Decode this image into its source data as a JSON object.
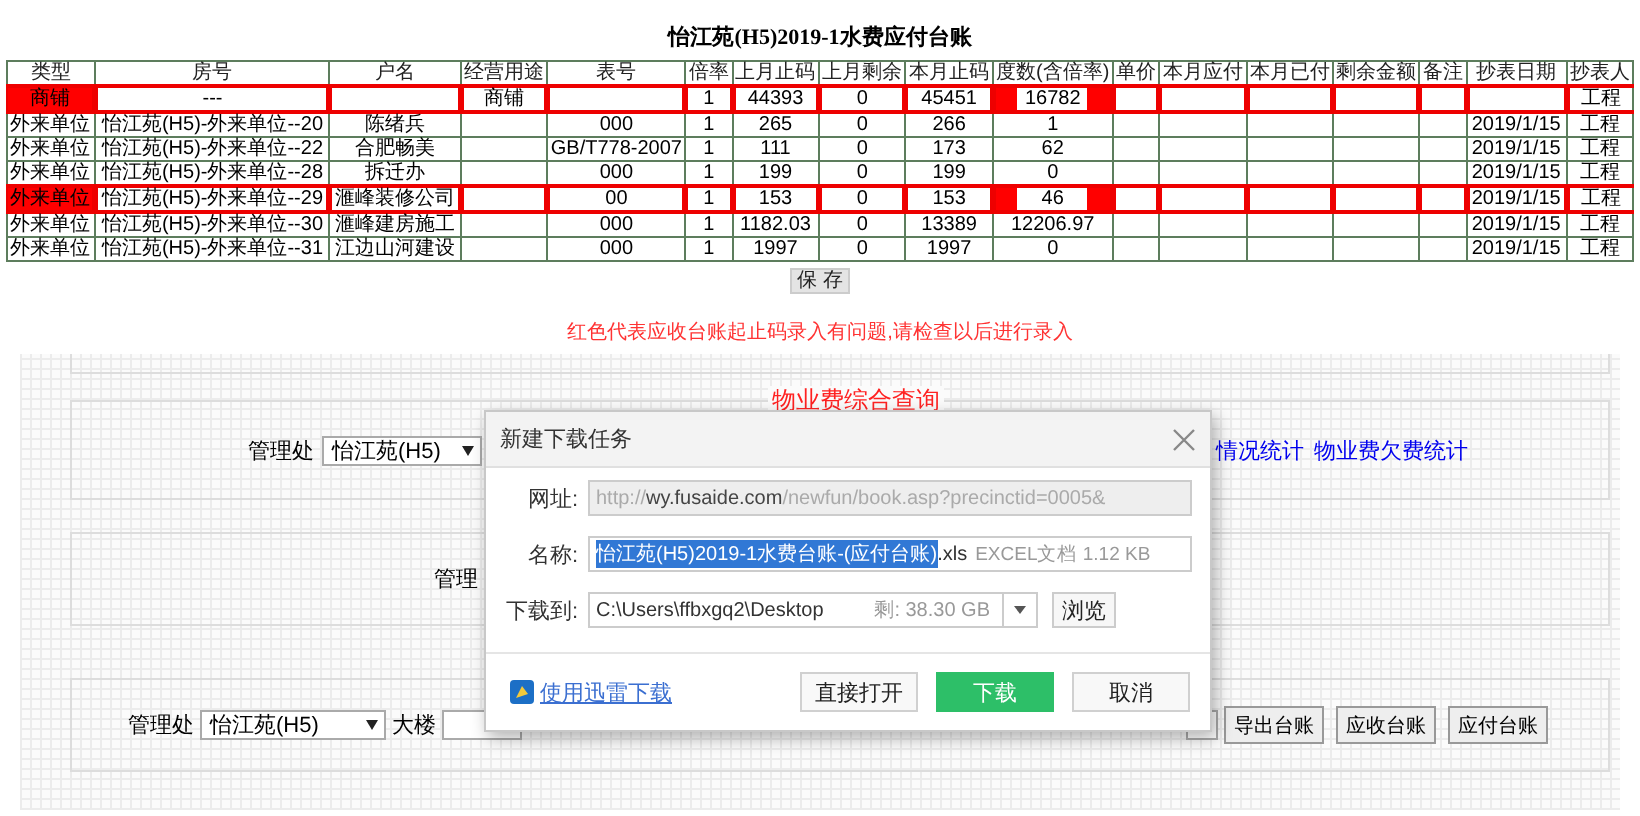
{
  "title": "怡江苑(H5)2019-1水费应付台账",
  "table": {
    "columns": [
      "类型",
      "房号",
      "户名",
      "经营用途",
      "表号",
      "倍率",
      "上月止码",
      "上月剩余",
      "本月止码",
      "度数(含倍率)",
      "单价",
      "本月应付",
      "本月已付",
      "剩余金额",
      "备注",
      "抄表日期",
      "抄表人"
    ],
    "rows": [
      {
        "flagged": true,
        "cells": [
          "商铺",
          "---",
          "",
          "商铺",
          "",
          "1",
          "44393",
          "0",
          "45451",
          "16782",
          "",
          "",
          "",
          "",
          "",
          "",
          "工程"
        ]
      },
      {
        "flagged": false,
        "cells": [
          "外来单位",
          "怡江苑(H5)-外来单位--20",
          "陈绪兵",
          "",
          "000",
          "1",
          "265",
          "0",
          "266",
          "1",
          "",
          "",
          "",
          "",
          "",
          "2019/1/15",
          "工程"
        ]
      },
      {
        "flagged": false,
        "cells": [
          "外来单位",
          "怡江苑(H5)-外来单位--22",
          "合肥畅美",
          "",
          "GB/T778-2007",
          "1",
          "111",
          "0",
          "173",
          "62",
          "",
          "",
          "",
          "",
          "",
          "2019/1/15",
          "工程"
        ]
      },
      {
        "flagged": false,
        "cells": [
          "外来单位",
          "怡江苑(H5)-外来单位--28",
          "拆迁办",
          "",
          "000",
          "1",
          "199",
          "0",
          "199",
          "0",
          "",
          "",
          "",
          "",
          "",
          "2019/1/15",
          "工程"
        ]
      },
      {
        "flagged": true,
        "cells": [
          "外来单位",
          "怡江苑(H5)-外来单位--29",
          "滙峰装修公司",
          "",
          "00",
          "1",
          "153",
          "0",
          "153",
          "46",
          "",
          "",
          "",
          "",
          "",
          "2019/1/15",
          "工程"
        ]
      },
      {
        "flagged": false,
        "cells": [
          "外来单位",
          "怡江苑(H5)-外来单位--30",
          "滙峰建房施工",
          "",
          "000",
          "1",
          "1182.03",
          "0",
          "13389",
          "12206.97",
          "",
          "",
          "",
          "",
          "",
          "2019/1/15",
          "工程"
        ]
      },
      {
        "flagged": false,
        "cells": [
          "外来单位",
          "怡江苑(H5)-外来单位--31",
          "江边山河建设",
          "",
          "000",
          "1",
          "1997",
          "0",
          "1997",
          "0",
          "",
          "",
          "",
          "",
          "",
          "2019/1/15",
          "工程"
        ]
      }
    ]
  },
  "save_button": "保 存",
  "note": "红色代表应收台账起止码录入有问题,请检查以后进行录入",
  "query_panel": {
    "legend": "物业费综合查询",
    "office_label": "管理处",
    "office_select": "怡江苑(H5)",
    "links": [
      "情况统计",
      "物业费欠费统计"
    ]
  },
  "second_panel": {
    "label": "管理"
  },
  "ledger_panel": {
    "office_label": "管理处",
    "office_select": "怡江苑(H5)",
    "building_label": "大楼",
    "buttons": [
      "导出台账",
      "应收台账",
      "应付台账"
    ]
  },
  "dialog": {
    "title": "新建下载任务",
    "url_label": "网址:",
    "url": "http://**wy.fusaide.com**/newfun/book.asp?precinctid=0005&",
    "name_label": "名称:",
    "name_selected": "怡江苑(H5)2019-1水费台账-(应付台账)",
    "name_rest": ".xls",
    "file_info": "EXCEL文档 1.12 KB",
    "dest_label": "下载到:",
    "dest": "C:\\Users\\ffbxgq2\\Desktop",
    "free_space": "剩: 38.30 GB",
    "browse": "浏览",
    "thunder_link": "使用迅雷下载",
    "buttons": [
      {
        "label": "直接打开",
        "kind": "normal"
      },
      {
        "label": "下载",
        "kind": "primary"
      },
      {
        "label": "取消",
        "kind": "normal"
      }
    ]
  }
}
